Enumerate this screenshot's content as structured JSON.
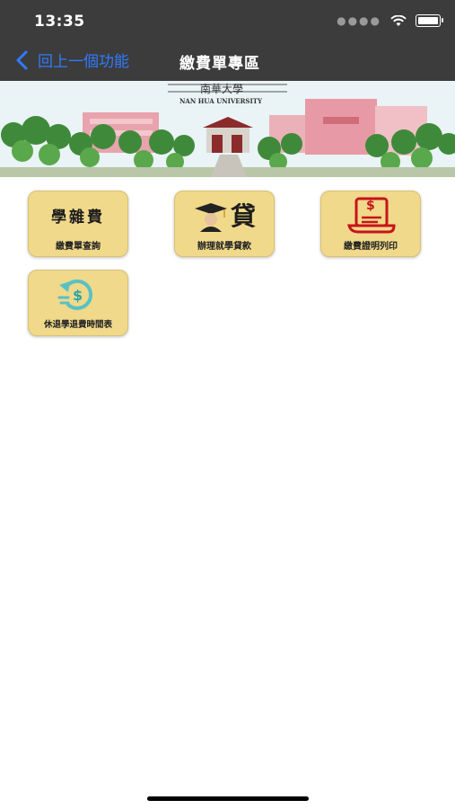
{
  "status_bar": {
    "time": "13:35"
  },
  "nav": {
    "back_label": "回上一個功能",
    "title": "繳費單專區"
  },
  "banner": {
    "cn_name": "南華大學",
    "en_name": "NAN HUA UNIVERSITY"
  },
  "tiles": [
    {
      "label": "繳費單查詢",
      "icon_text": "學雜費",
      "icon": "tuition-icon"
    },
    {
      "label": "辦理就學貸款",
      "icon_text": "貸",
      "icon": "student-loan-icon"
    },
    {
      "label": "繳費證明列印",
      "icon_text": "$",
      "icon": "receipt-print-icon"
    },
    {
      "label": "休退學退費時間表",
      "icon_text": "$",
      "icon": "refund-icon"
    }
  ],
  "colors": {
    "tile_bg": "#f0d98a",
    "nav_bg": "#3c3c3c",
    "link_blue": "#2f7bff"
  }
}
